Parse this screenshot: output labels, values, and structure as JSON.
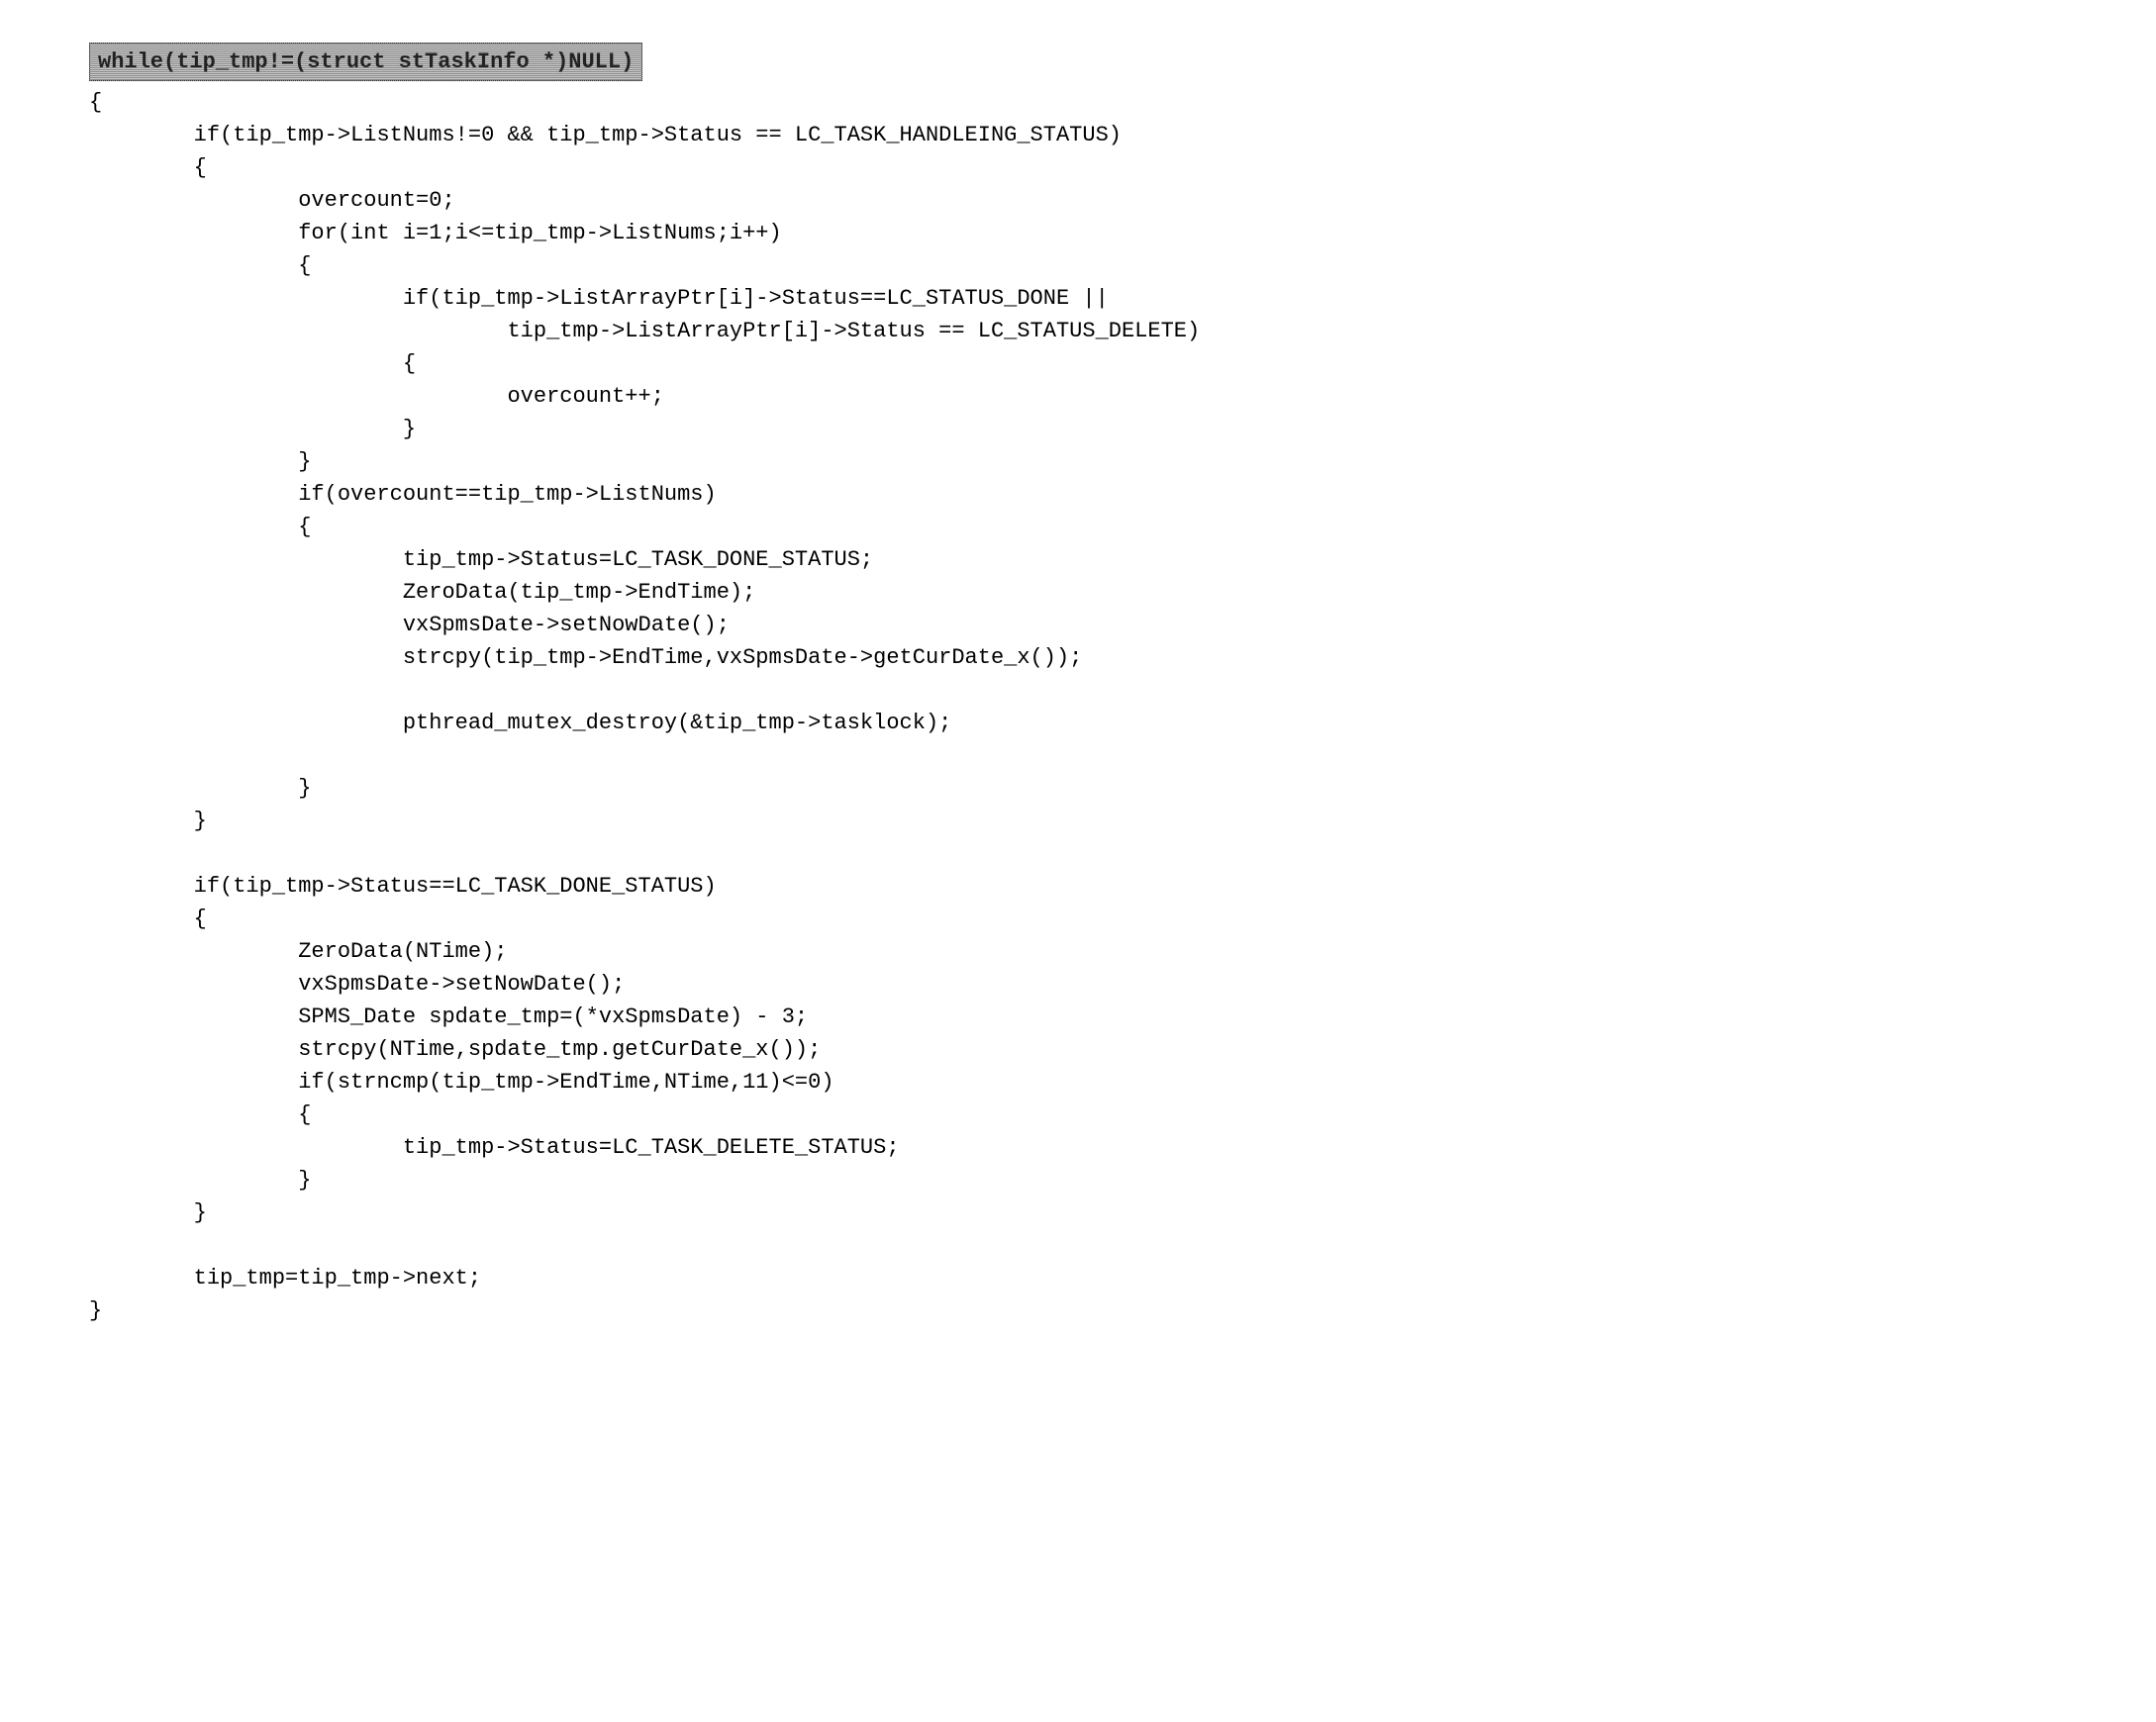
{
  "code": {
    "highlighted": "while(tip_tmp!=(struct stTaskInfo *)NULL)",
    "lines": [
      "{",
      "        if(tip_tmp->ListNums!=0 && tip_tmp->Status == LC_TASK_HANDLEING_STATUS)",
      "        {",
      "                overcount=0;",
      "                for(int i=1;i<=tip_tmp->ListNums;i++)",
      "                {",
      "                        if(tip_tmp->ListArrayPtr[i]->Status==LC_STATUS_DONE ||",
      "                                tip_tmp->ListArrayPtr[i]->Status == LC_STATUS_DELETE)",
      "                        {",
      "                                overcount++;",
      "                        }",
      "                }",
      "                if(overcount==tip_tmp->ListNums)",
      "                {",
      "                        tip_tmp->Status=LC_TASK_DONE_STATUS;",
      "                        ZeroData(tip_tmp->EndTime);",
      "                        vxSpmsDate->setNowDate();",
      "                        strcpy(tip_tmp->EndTime,vxSpmsDate->getCurDate_x());",
      "",
      "                        pthread_mutex_destroy(&tip_tmp->tasklock);",
      "",
      "                }",
      "        }",
      "",
      "        if(tip_tmp->Status==LC_TASK_DONE_STATUS)",
      "        {",
      "                ZeroData(NTime);",
      "                vxSpmsDate->setNowDate();",
      "                SPMS_Date spdate_tmp=(*vxSpmsDate) - 3;",
      "                strcpy(NTime,spdate_tmp.getCurDate_x());",
      "                if(strncmp(tip_tmp->EndTime,NTime,11)<=0)",
      "                {",
      "                        tip_tmp->Status=LC_TASK_DELETE_STATUS;",
      "                }",
      "        }",
      "",
      "        tip_tmp=tip_tmp->next;",
      "}"
    ]
  }
}
